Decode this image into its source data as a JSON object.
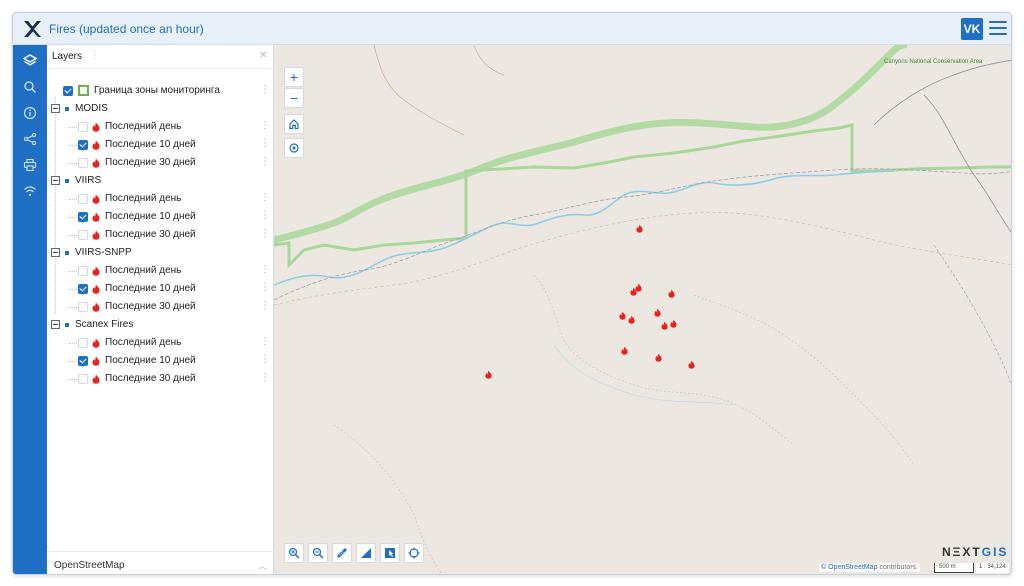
{
  "header": {
    "title": "Fires (updated once an hour)",
    "user_initials": "VK"
  },
  "sidebar": {
    "icons": [
      "layers-icon",
      "search-icon",
      "info-icon",
      "share-icon",
      "print-icon",
      "wifi-icon"
    ]
  },
  "layers_panel": {
    "title": "Layers",
    "items": [
      {
        "label": "Граница зоны мониторинга",
        "checked": true,
        "kind": "boundary"
      },
      {
        "label": "MODIS",
        "kind": "group"
      },
      {
        "label": "Последний день",
        "checked": false,
        "kind": "fire"
      },
      {
        "label": "Последние 10 дней",
        "checked": true,
        "kind": "fire"
      },
      {
        "label": "Последние 30 дней",
        "checked": false,
        "kind": "fire"
      },
      {
        "label": "VIIRS",
        "kind": "group"
      },
      {
        "label": "Последний день",
        "checked": false,
        "kind": "fire"
      },
      {
        "label": "Последние 10 дней",
        "checked": true,
        "kind": "fire"
      },
      {
        "label": "Последние 30 дней",
        "checked": false,
        "kind": "fire"
      },
      {
        "label": "VIIRS-SNPP",
        "kind": "group"
      },
      {
        "label": "Последний день",
        "checked": false,
        "kind": "fire"
      },
      {
        "label": "Последние 10 дней",
        "checked": true,
        "kind": "fire"
      },
      {
        "label": "Последние 30 дней",
        "checked": false,
        "kind": "fire"
      },
      {
        "label": "Scanex Fires",
        "kind": "group"
      },
      {
        "label": "Последний день",
        "checked": false,
        "kind": "fire"
      },
      {
        "label": "Последние 10 дней",
        "checked": true,
        "kind": "fire"
      },
      {
        "label": "Последние 30 дней",
        "checked": false,
        "kind": "fire"
      }
    ],
    "basemap": "OpenStreetMap"
  },
  "map": {
    "area_label": "Canyons National Conservation Area",
    "attribution_link": "© OpenStreetMap",
    "attribution_rest": " contributors.",
    "scale_text": "500 m",
    "ratio_text": "1 : 34,124",
    "brand_left": "NΞXT",
    "brand_right": "GIS",
    "zoom_in_label": "+",
    "zoom_out_label": "−"
  },
  "colors": {
    "primary": "#1f6fc4",
    "fire": "#e8221c",
    "boundary": "#8bc77a",
    "river": "#8fcde6"
  }
}
